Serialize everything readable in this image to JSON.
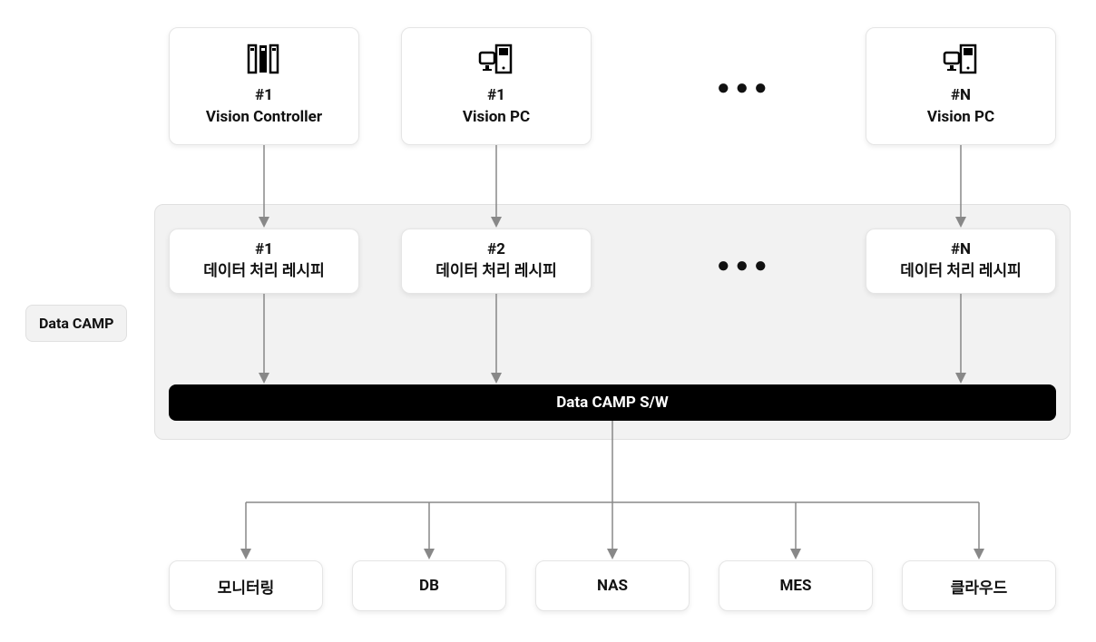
{
  "top_row": {
    "nodes": [
      {
        "id": "#1",
        "label": "Vision Controller",
        "icon": "servers-icon"
      },
      {
        "id": "#1",
        "label": "Vision PC",
        "icon": "pc-icon"
      },
      {
        "id": "#N",
        "label": "Vision PC",
        "icon": "pc-icon"
      }
    ],
    "ellipsis": "●●●"
  },
  "datacamp": {
    "label": "Data CAMP",
    "recipes": [
      {
        "id": "#1",
        "label": "데이터 처리 레시피"
      },
      {
        "id": "#2",
        "label": "데이터 처리 레시피"
      },
      {
        "id": "#N",
        "label": "데이터 처리 레시피"
      }
    ],
    "ellipsis": "●●●",
    "sw_bar": "Data CAMP S/W"
  },
  "outputs": [
    "모니터링",
    "DB",
    "NAS",
    "MES",
    "클라우드"
  ]
}
